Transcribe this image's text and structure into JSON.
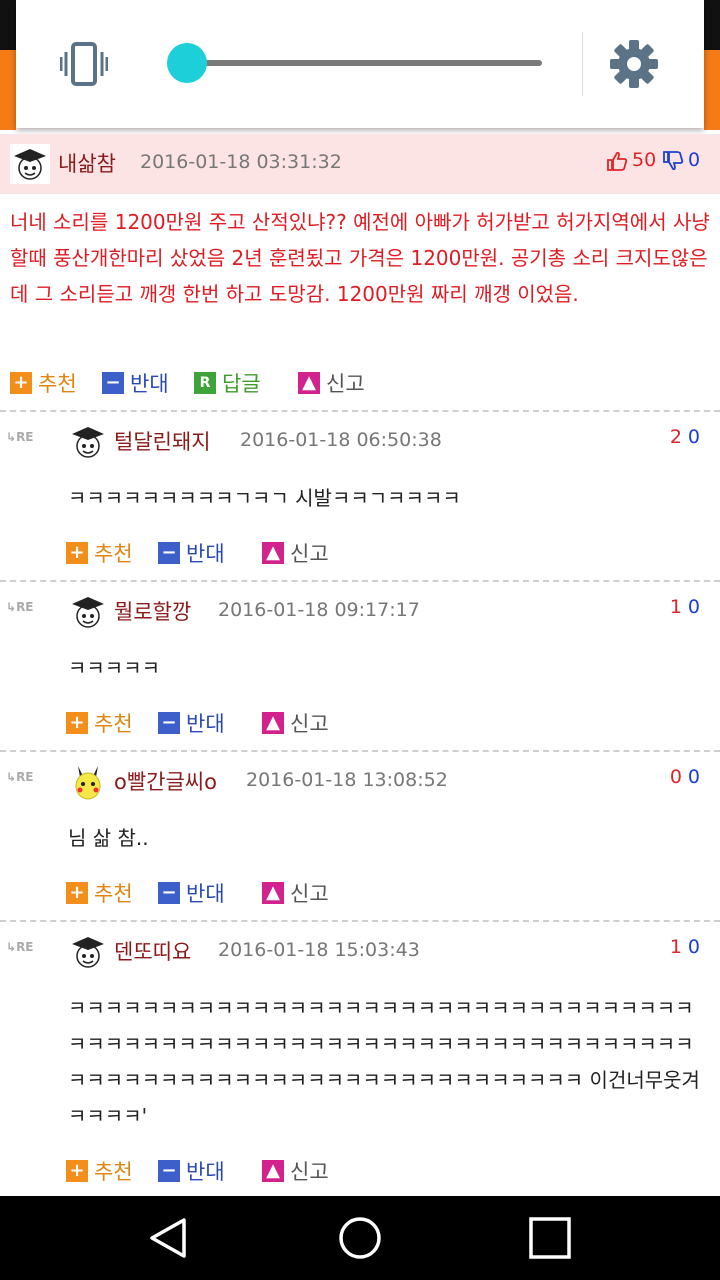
{
  "brightness_panel": {
    "brightness_level": 0.05,
    "icons": [
      "vibrate-icon",
      "settings-gear-icon"
    ]
  },
  "post": {
    "nickname": "내삶참",
    "datetime": "2016-01-18 03:31:32",
    "upvotes": "50",
    "downvotes": "0",
    "body": "너네 소리를 1200만원 주고 산적있냐?? 예전에 아빠가 허가받고 허가지역에서 사냥할때 풍산개한마리 샀었음 2년 훈련됬고 가격은 1200만원. 공기총 소리 크지도않은데 그 소리듣고 깨갱 한번 하고 도망감. 1200만원 짜리 깨갱 이었음.",
    "actions": {
      "recommend": "추천",
      "oppose": "반대",
      "reply": "답글",
      "report": "신고"
    }
  },
  "re_label": "RE",
  "comments": [
    {
      "nickname": "털달린돼지",
      "datetime": "2016-01-18 06:50:38",
      "up": "2",
      "down": "0",
      "body": "ㅋㅋㅋㅋㅋㅋㅋㅋㅋㄱㅋㄱ 시발ㅋㅋㄱㅋㅋㅋㅋ",
      "actions": {
        "recommend": "추천",
        "oppose": "반대",
        "report": "신고"
      }
    },
    {
      "nickname": "뭘로할깡",
      "datetime": "2016-01-18 09:17:17",
      "up": "1",
      "down": "0",
      "body": "ㅋㅋㅋㅋㅋ",
      "actions": {
        "recommend": "추천",
        "oppose": "반대",
        "report": "신고"
      }
    },
    {
      "nickname": "o빨간글씨o",
      "datetime": "2016-01-18 13:08:52",
      "up": "0",
      "down": "0",
      "body": "님 삶 참..",
      "actions": {
        "recommend": "추천",
        "oppose": "반대",
        "report": "신고"
      }
    },
    {
      "nickname": "덴또띠요",
      "datetime": "2016-01-18 15:03:43",
      "up": "1",
      "down": "0",
      "body": "ㅋㅋㅋㅋㅋㅋㅋㅋㅋㅋㅋㅋㅋㅋㅋㅋㅋㅋㅋㅋㅋㅋㅋㅋㅋㅋㅋㅋㅋㅋㅋㅋㅋㅋㅋㅋㅋㅋㅋㅋㅋㅋㅋㅋㅋㅋㅋㅋㅋㅋㅋㅋㅋㅋㅋㅋㅋㅋㅋㅋㅋㅋㅋㅋㅋㅋㅋㅋㅋㅋㅋㅋㅋㅋㅋㅋㅋㅋㅋㅋㅋㅋㅋㅋㅋㅋㅋㅋㅋㅋㅋㅋㅋㅋㅋㅋ 이건너무웃겨 ㅋㅋㅋㅋ'",
      "actions": {
        "recommend": "추천",
        "oppose": "반대",
        "report": "신고"
      }
    }
  ],
  "navbar": {
    "icons": [
      "back-icon",
      "home-icon",
      "recents-icon"
    ]
  },
  "colors": {
    "accent_orange": "#f57b16",
    "slider_thumb": "#1ccfd9",
    "post_text": "#e11b23",
    "nickname": "#8b1a1a"
  }
}
